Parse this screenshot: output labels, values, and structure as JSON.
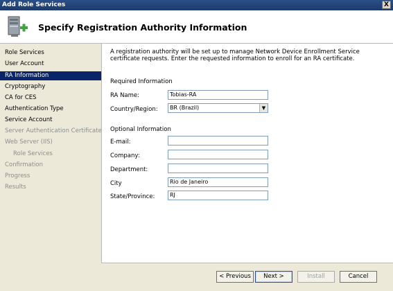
{
  "window": {
    "title": "Add Role Services",
    "close_label": "X"
  },
  "header": {
    "title": "Specify Registration Authority Information",
    "icon": "server-add-icon"
  },
  "nav": {
    "items": [
      {
        "label": "Role Services",
        "state": "normal"
      },
      {
        "label": "User Account",
        "state": "normal"
      },
      {
        "label": "RA Information",
        "state": "active"
      },
      {
        "label": "Cryptography",
        "state": "normal"
      },
      {
        "label": "CA for CES",
        "state": "normal"
      },
      {
        "label": "Authentication Type",
        "state": "normal"
      },
      {
        "label": "Service Account",
        "state": "normal"
      },
      {
        "label": "Server Authentication Certificate",
        "state": "disabled"
      },
      {
        "label": "Web Server (IIS)",
        "state": "disabled"
      },
      {
        "label": "Role Services",
        "state": "disabled-sub"
      },
      {
        "label": "Confirmation",
        "state": "disabled"
      },
      {
        "label": "Progress",
        "state": "disabled"
      },
      {
        "label": "Results",
        "state": "disabled"
      }
    ]
  },
  "content": {
    "intro": "A registration authority will be set up to manage Network Device Enrollment Service certificate requests. Enter the requested information to enroll for an RA certificate.",
    "required_heading": "Required Information",
    "ra_name": {
      "label": "RA Name:",
      "value": "Tobias-RA"
    },
    "country": {
      "label": "Country/Region:",
      "value": "BR (Brazil)"
    },
    "optional_heading": "Optional Information",
    "email": {
      "label": "E-mail:",
      "value": ""
    },
    "company": {
      "label": "Company:",
      "value": ""
    },
    "department": {
      "label": "Department:",
      "value": ""
    },
    "city": {
      "label": "City",
      "value": "Rio de Janeiro"
    },
    "state": {
      "label": "State/Province:",
      "value": "RJ"
    }
  },
  "buttons": {
    "previous": "< Previous",
    "next": "Next >",
    "install": "Install",
    "cancel": "Cancel"
  }
}
